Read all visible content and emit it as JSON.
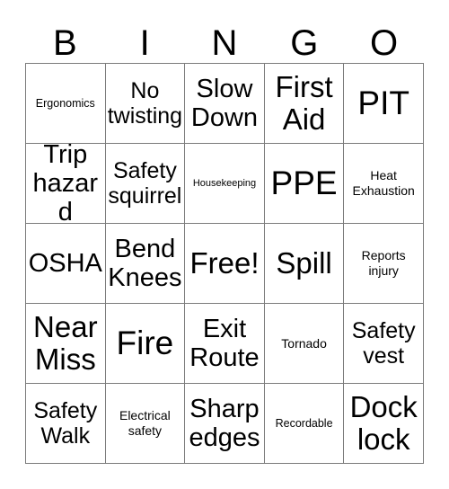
{
  "card": {
    "title": "BINGO",
    "headers": [
      "B",
      "I",
      "N",
      "G",
      "O"
    ],
    "colors": {
      "background": "#ffffff",
      "text": "#000000",
      "grid_line": "#7b7b7b"
    },
    "rows": [
      {
        "cells": [
          {
            "label": "Ergonomics",
            "size": "sz-s"
          },
          {
            "label": "No twisting",
            "size": "sz-l"
          },
          {
            "label": "Slow Down",
            "size": "sz-xl"
          },
          {
            "label": "First Aid",
            "size": "sz-2xl"
          },
          {
            "label": "PIT",
            "size": "sz-3xl"
          }
        ]
      },
      {
        "cells": [
          {
            "label": "Trip hazard",
            "size": "sz-xl"
          },
          {
            "label": "Safety squirrel",
            "size": "sz-l"
          },
          {
            "label": "Housekeeping",
            "size": "sz-xs"
          },
          {
            "label": "PPE",
            "size": "sz-3xl"
          },
          {
            "label": "Heat Exhaustion",
            "size": "sz-m"
          }
        ]
      },
      {
        "cells": [
          {
            "label": "OSHA",
            "size": "sz-xl"
          },
          {
            "label": "Bend Knees",
            "size": "sz-xl"
          },
          {
            "label": "Free!",
            "size": "sz-2xl"
          },
          {
            "label": "Spill",
            "size": "sz-2xl"
          },
          {
            "label": "Reports injury",
            "size": "sz-m"
          }
        ]
      },
      {
        "cells": [
          {
            "label": "Near Miss",
            "size": "sz-2xl"
          },
          {
            "label": "Fire",
            "size": "sz-3xl"
          },
          {
            "label": "Exit Route",
            "size": "sz-xl"
          },
          {
            "label": "Tornado",
            "size": "sz-m"
          },
          {
            "label": "Safety vest",
            "size": "sz-l"
          }
        ]
      },
      {
        "cells": [
          {
            "label": "Safety Walk",
            "size": "sz-l"
          },
          {
            "label": "Electrical safety",
            "size": "sz-m"
          },
          {
            "label": "Sharp edges",
            "size": "sz-xl"
          },
          {
            "label": "Recordable",
            "size": "sz-s"
          },
          {
            "label": "Dock lock",
            "size": "sz-2xl"
          }
        ]
      }
    ]
  }
}
